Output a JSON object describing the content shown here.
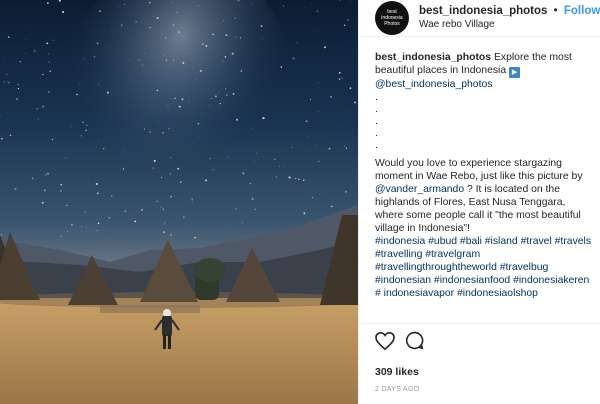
{
  "post": {
    "username": "best_indonesia_photos",
    "follow_label": "Follow",
    "location": "Wae rebo Village",
    "avatar_text": [
      "best",
      "indonesia",
      "Photos"
    ],
    "caption": {
      "username": "best_indonesia_photos",
      "intro": " Explore the most beautiful places in Indonesia ",
      "play_glyph": "▶",
      "mention_top": "@best_indonesia_photos",
      "dots": [
        ".",
        ".",
        ".",
        ".",
        "."
      ],
      "body_1": "Would you love to experience stargazing moment in Wae Rebo, just like this picture by ",
      "mention_credit": "@vander_armando",
      "body_2": " ? It is located on the highlands of Flores, East Nusa Tenggara, where some people call it \"the most beautiful village in Indonesia\"!",
      "hashtags": "#indonesia #ubud #bali #island #travel #travels #travelling #travelgram #travellingthroughtheworld #travelbug #indonesian #indonesianfood #indonesiakeren # indonesiavapor #indonesiaolshop"
    },
    "likes": "309 likes",
    "timestamp": "2 DAYS AGO"
  },
  "icons": {
    "like": "heart-outline-icon",
    "comment": "comment-bubble-icon"
  },
  "colors": {
    "follow": "#3897f0",
    "link": "#003569",
    "timestamp": "#999999"
  }
}
